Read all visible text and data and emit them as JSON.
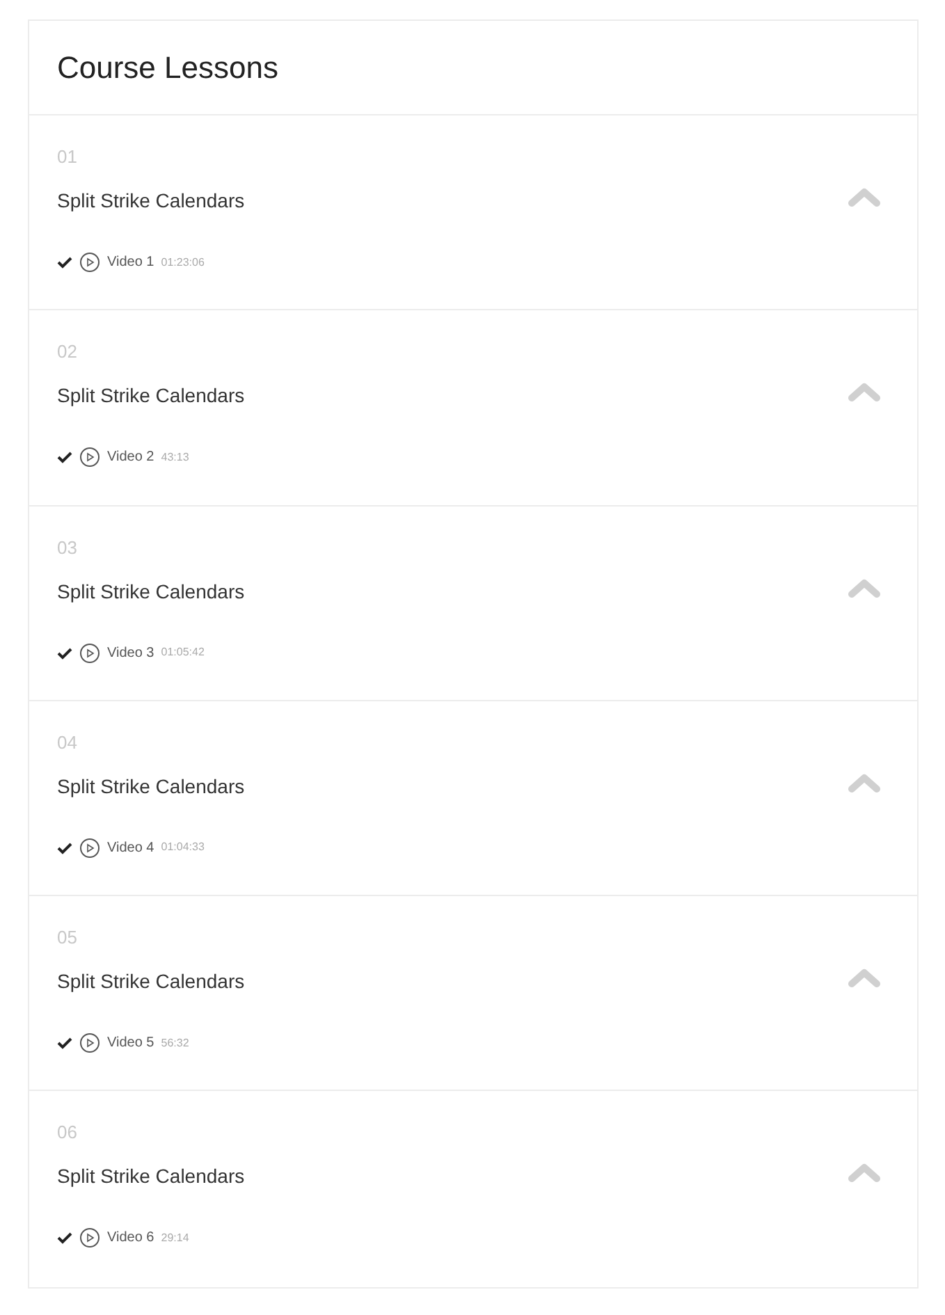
{
  "title": "Course Lessons",
  "lessons": [
    {
      "number": "01",
      "title": "Split Strike Calendars",
      "expanded": true,
      "completed": true,
      "video": "Video 1",
      "duration": "01:23:06"
    },
    {
      "number": "02",
      "title": "Split Strike Calendars",
      "expanded": true,
      "completed": true,
      "video": "Video 2",
      "duration": "43:13"
    },
    {
      "number": "03",
      "title": "Split Strike Calendars",
      "expanded": true,
      "completed": true,
      "video": "Video 3",
      "duration": "01:05:42"
    },
    {
      "number": "04",
      "title": "Split Strike Calendars",
      "expanded": true,
      "completed": true,
      "video": "Video 4",
      "duration": "01:04:33"
    },
    {
      "number": "05",
      "title": "Split Strike Calendars",
      "expanded": true,
      "completed": true,
      "video": "Video 5",
      "duration": "56:32"
    },
    {
      "number": "06",
      "title": "Split Strike Calendars",
      "expanded": true,
      "completed": true,
      "video": "Video 6",
      "duration": "29:14"
    }
  ]
}
